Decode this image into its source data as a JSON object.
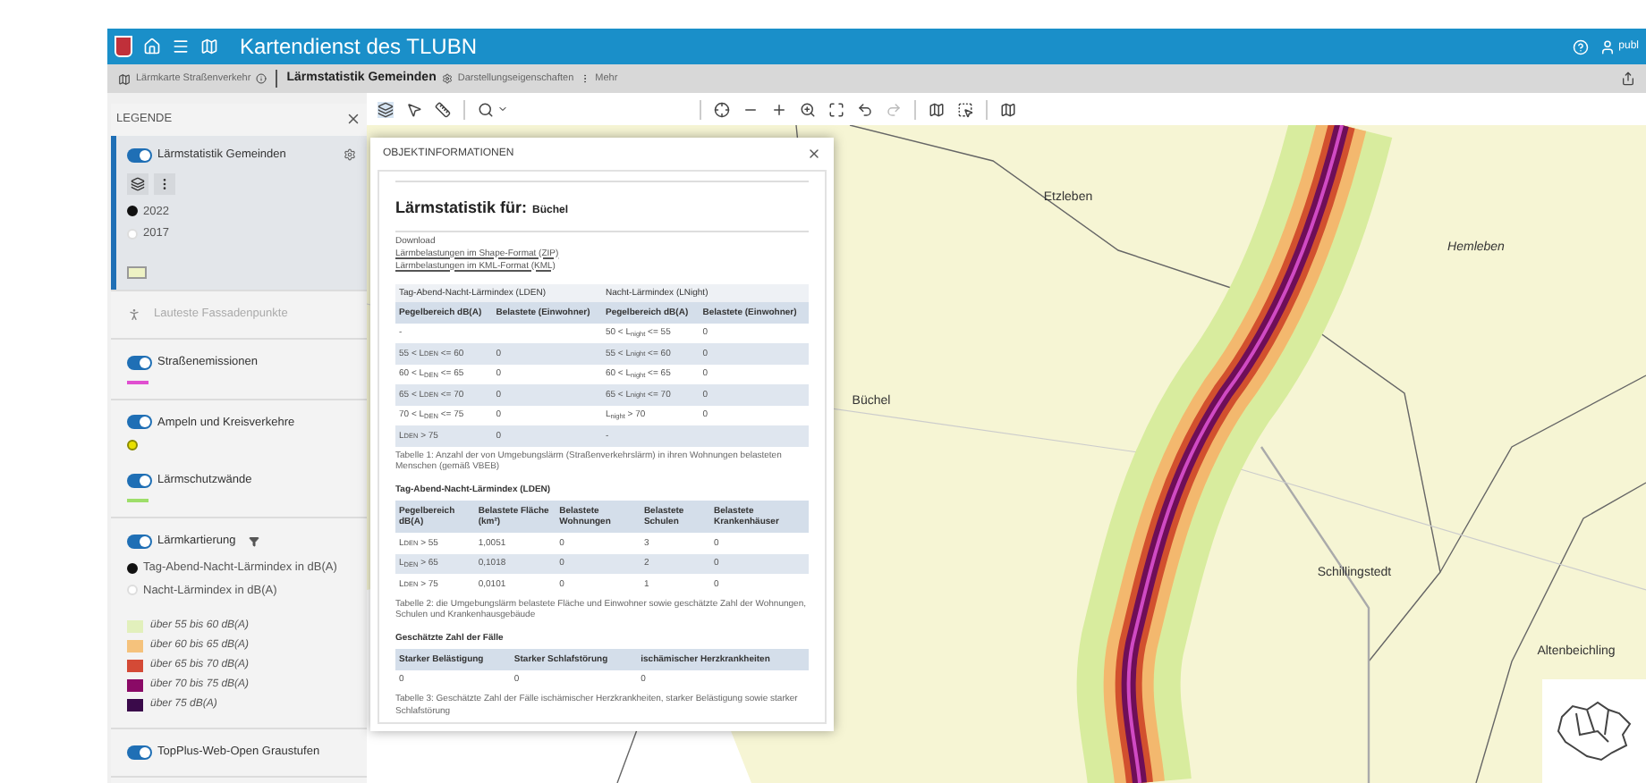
{
  "header": {
    "title": "Kartendienst des TLUBN",
    "user": "publ"
  },
  "breadcrumb": [
    {
      "label": "Lärmkarte Straßenverkehr",
      "kind": "layer",
      "selected": false
    },
    {
      "label": "Lärmstatistik Gemeinden",
      "kind": "current",
      "selected": true
    },
    {
      "label": "Darstellungseigenschaften",
      "kind": "properties",
      "selected": false
    },
    {
      "label": "Mehr",
      "kind": "more",
      "selected": false
    }
  ],
  "legend": {
    "title": "LEGENDE",
    "groups": [
      [
        {
          "name": "Lärmstatistik Gemeinden",
          "on": true,
          "selected": true,
          "disabled": false,
          "settings": true,
          "options": [
            {
              "label": "2022",
              "selected": true
            },
            {
              "label": "2017",
              "selected": false
            }
          ],
          "symbol": {
            "kind": "fill",
            "color": "#eef2c4"
          }
        }
      ],
      [
        {
          "name": "Lauteste Fassadenpunkte",
          "selected": false,
          "disabled": true
        }
      ],
      [
        {
          "name": "Straßenemissionen",
          "on": true,
          "selected": false,
          "disabled": false,
          "symbol": {
            "kind": "line",
            "color": "#e04fd0"
          }
        }
      ],
      [
        {
          "name": "Ampeln und Kreisverkehre",
          "on": true,
          "selected": false,
          "disabled": false,
          "symbol": {
            "kind": "point",
            "color": "#e8e000"
          }
        },
        {
          "name": "Lärmschutzwände",
          "on": true,
          "selected": false,
          "disabled": false,
          "symbol": {
            "kind": "line",
            "color": "#9ede6a"
          }
        }
      ],
      [
        {
          "name": "Lärmkartierung",
          "on": true,
          "selected": false,
          "disabled": false,
          "filter": true,
          "options": [
            {
              "label": "Tag-Abend-Nacht-Lärmindex in dB(A)",
              "selected": true
            },
            {
              "label": "Nacht-Lärmindex in dB(A)",
              "selected": false
            }
          ],
          "classes": [
            {
              "label": "über 55 bis 60 dB(A)",
              "color": "#e2f0bc"
            },
            {
              "label": "über 60 bis 65 dB(A)",
              "color": "#f5c27c"
            },
            {
              "label": "über 65 bis 70 dB(A)",
              "color": "#d44a36"
            },
            {
              "label": "über 70 bis 75 dB(A)",
              "color": "#8a0a66"
            },
            {
              "label": "über 75 dB(A)",
              "color": "#3a0a4a"
            }
          ]
        }
      ],
      [
        {
          "name": "TopPlus-Web-Open Graustufen",
          "on": true,
          "selected": false,
          "disabled": false
        }
      ]
    ]
  },
  "popup": {
    "title": "OBJEKTINFORMATIONEN",
    "heading": "Lärmstatistik für:",
    "place": "Büchel",
    "download_label": "Download",
    "links": [
      "Lärmbelastungen im Shape-Format (ZIP)",
      "Lärmbelastungen im KML-Format (KML)"
    ],
    "table1": {
      "groups": [
        "Tag-Abend-Nacht-Lärmindex (LDEN)",
        "Nacht-Lärmindex (LNight)"
      ],
      "columns": [
        "Pegelbereich dB(A)",
        "Belastete (Einwohner)",
        "Pegelbereich dB(A)",
        "Belastete (Einwohner)"
      ],
      "rows": [
        [
          "-",
          null,
          "50 < L$_{night}$ <= 55",
          "0"
        ],
        [
          "55 < L$_{DEN}$ <= 60",
          "0",
          "55 < L$_{night}$ <= 60",
          "0"
        ],
        [
          "60 < L$_{DEN}$ <= 65",
          "0",
          "60 < L$_{night}$ <= 65",
          "0"
        ],
        [
          "65 < L$_{DEN}$ <= 70",
          "0",
          "65 < L$_{night}$ <= 70",
          "0"
        ],
        [
          "70 < L$_{DEN}$ <= 75",
          "0",
          "L$_{night}$ > 70",
          "0"
        ],
        [
          "L$_{DEN}$ > 75",
          "0",
          "-",
          null
        ]
      ],
      "caption": "Tabelle 1: Anzahl der von Umgebungslärm (Straßenverkehrslärm) in ihren Wohnungen belasteten Menschen (gemäß VBEB)"
    },
    "table2": {
      "title": "Tag-Abend-Nacht-Lärmindex (LDEN)",
      "columns": [
        "Pegelbereich dB(A)",
        "Belastete Fläche (km²)",
        "Belastete Wohnungen",
        "Belastete Schulen",
        "Belastete Krankenhäuser"
      ],
      "rows": [
        [
          "L$_{DEN}$ > 55",
          "1,0051",
          "0",
          "3",
          "0"
        ],
        [
          "L$_{DEN}$ > 65",
          "0,1018",
          "0",
          "2",
          "0"
        ],
        [
          "L$_{DEN}$ > 75",
          "0,0101",
          "0",
          "1",
          "0"
        ]
      ],
      "caption": "Tabelle 2: die Umgebungslärm belastete Fläche und Einwohner sowie geschätzte Zahl der Wohnungen, Schulen und Krankenhausgebäude"
    },
    "table3": {
      "title": "Geschätzte Zahl der Fälle",
      "columns": [
        "Starker Belästigung",
        "Starker Schlafstörung",
        "ischämischer Herzkrankheiten"
      ],
      "rows": [
        [
          "0",
          "0",
          "0"
        ]
      ],
      "caption": "Tabelle 3: Geschätzte Zahl der Fälle ischämischer Herzkrankheiten, starker Belästigung sowie starker Schlafstörung"
    }
  },
  "map": {
    "labels": [
      {
        "text": "Etzleben",
        "italic": false
      },
      {
        "text": "Büchel",
        "italic": false
      },
      {
        "text": "Hemleben",
        "italic": true
      },
      {
        "text": "Schillingstedt",
        "italic": false
      },
      {
        "text": "Altenbeichling",
        "italic": false
      }
    ]
  }
}
